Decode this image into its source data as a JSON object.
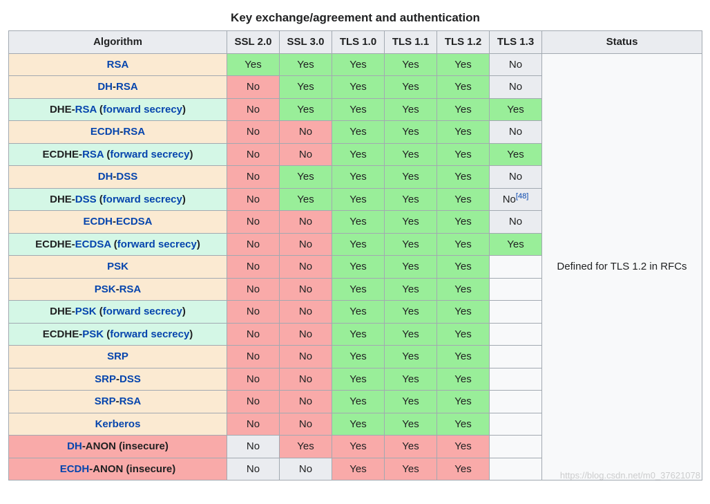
{
  "caption": "Key exchange/agreement and authentication",
  "headers": {
    "algorithm": "Algorithm",
    "protocols": [
      "SSL 2.0",
      "SSL 3.0",
      "TLS 1.0",
      "TLS 1.1",
      "TLS 1.2",
      "TLS 1.3"
    ],
    "status": "Status"
  },
  "status_text": "Defined for TLS 1.2 in RFCs",
  "watermark": "https://blog.csdn.net/m0_37621078",
  "rows": [
    {
      "algBg": "peach",
      "name": [
        {
          "t": "RSA",
          "link": true
        }
      ],
      "cells": [
        {
          "v": "Yes",
          "bg": "green"
        },
        {
          "v": "Yes",
          "bg": "green"
        },
        {
          "v": "Yes",
          "bg": "green"
        },
        {
          "v": "Yes",
          "bg": "green"
        },
        {
          "v": "Yes",
          "bg": "green"
        },
        {
          "v": "No",
          "bg": "grey"
        }
      ]
    },
    {
      "algBg": "peach",
      "name": [
        {
          "t": "DH",
          "link": true
        },
        {
          "t": "-",
          "link": false
        },
        {
          "t": "RSA",
          "link": true
        }
      ],
      "cells": [
        {
          "v": "No",
          "bg": "red"
        },
        {
          "v": "Yes",
          "bg": "green"
        },
        {
          "v": "Yes",
          "bg": "green"
        },
        {
          "v": "Yes",
          "bg": "green"
        },
        {
          "v": "Yes",
          "bg": "green"
        },
        {
          "v": "No",
          "bg": "grey"
        }
      ]
    },
    {
      "algBg": "mint",
      "name": [
        {
          "t": "DHE-",
          "link": false,
          "bold": true
        },
        {
          "t": "RSA",
          "link": true
        },
        {
          "t": " (",
          "link": false,
          "bold": true
        },
        {
          "t": "forward secrecy",
          "link": true
        },
        {
          "t": ")",
          "link": false,
          "bold": true
        }
      ],
      "cells": [
        {
          "v": "No",
          "bg": "red"
        },
        {
          "v": "Yes",
          "bg": "green"
        },
        {
          "v": "Yes",
          "bg": "green"
        },
        {
          "v": "Yes",
          "bg": "green"
        },
        {
          "v": "Yes",
          "bg": "green"
        },
        {
          "v": "Yes",
          "bg": "green"
        }
      ]
    },
    {
      "algBg": "peach",
      "name": [
        {
          "t": "ECDH",
          "link": true
        },
        {
          "t": "-",
          "link": false
        },
        {
          "t": "RSA",
          "link": true
        }
      ],
      "cells": [
        {
          "v": "No",
          "bg": "red"
        },
        {
          "v": "No",
          "bg": "red"
        },
        {
          "v": "Yes",
          "bg": "green"
        },
        {
          "v": "Yes",
          "bg": "green"
        },
        {
          "v": "Yes",
          "bg": "green"
        },
        {
          "v": "No",
          "bg": "grey"
        }
      ]
    },
    {
      "algBg": "mint",
      "name": [
        {
          "t": "ECDHE-",
          "link": false,
          "bold": true
        },
        {
          "t": "RSA",
          "link": true
        },
        {
          "t": " (",
          "link": false,
          "bold": true
        },
        {
          "t": "forward secrecy",
          "link": true
        },
        {
          "t": ")",
          "link": false,
          "bold": true
        }
      ],
      "cells": [
        {
          "v": "No",
          "bg": "red"
        },
        {
          "v": "No",
          "bg": "red"
        },
        {
          "v": "Yes",
          "bg": "green"
        },
        {
          "v": "Yes",
          "bg": "green"
        },
        {
          "v": "Yes",
          "bg": "green"
        },
        {
          "v": "Yes",
          "bg": "green"
        }
      ]
    },
    {
      "algBg": "peach",
      "name": [
        {
          "t": "DH",
          "link": true
        },
        {
          "t": "-",
          "link": false
        },
        {
          "t": "DSS",
          "link": true
        }
      ],
      "cells": [
        {
          "v": "No",
          "bg": "red"
        },
        {
          "v": "Yes",
          "bg": "green"
        },
        {
          "v": "Yes",
          "bg": "green"
        },
        {
          "v": "Yes",
          "bg": "green"
        },
        {
          "v": "Yes",
          "bg": "green"
        },
        {
          "v": "No",
          "bg": "grey"
        }
      ]
    },
    {
      "algBg": "mint",
      "name": [
        {
          "t": "DHE-",
          "link": false,
          "bold": true
        },
        {
          "t": "DSS",
          "link": true
        },
        {
          "t": " (",
          "link": false,
          "bold": true
        },
        {
          "t": "forward secrecy",
          "link": true
        },
        {
          "t": ")",
          "link": false,
          "bold": true
        }
      ],
      "cells": [
        {
          "v": "No",
          "bg": "red"
        },
        {
          "v": "Yes",
          "bg": "green"
        },
        {
          "v": "Yes",
          "bg": "green"
        },
        {
          "v": "Yes",
          "bg": "green"
        },
        {
          "v": "Yes",
          "bg": "green"
        },
        {
          "v": "No",
          "bg": "grey",
          "ref": "[48]"
        }
      ]
    },
    {
      "algBg": "peach",
      "name": [
        {
          "t": "ECDH",
          "link": true
        },
        {
          "t": "-",
          "link": false
        },
        {
          "t": "ECDSA",
          "link": true
        }
      ],
      "cells": [
        {
          "v": "No",
          "bg": "red"
        },
        {
          "v": "No",
          "bg": "red"
        },
        {
          "v": "Yes",
          "bg": "green"
        },
        {
          "v": "Yes",
          "bg": "green"
        },
        {
          "v": "Yes",
          "bg": "green"
        },
        {
          "v": "No",
          "bg": "grey"
        }
      ]
    },
    {
      "algBg": "mint",
      "name": [
        {
          "t": "ECDHE-",
          "link": false,
          "bold": true
        },
        {
          "t": "ECDSA",
          "link": true
        },
        {
          "t": " (",
          "link": false,
          "bold": true
        },
        {
          "t": "forward secrecy",
          "link": true
        },
        {
          "t": ")",
          "link": false,
          "bold": true
        }
      ],
      "cells": [
        {
          "v": "No",
          "bg": "red"
        },
        {
          "v": "No",
          "bg": "red"
        },
        {
          "v": "Yes",
          "bg": "green"
        },
        {
          "v": "Yes",
          "bg": "green"
        },
        {
          "v": "Yes",
          "bg": "green"
        },
        {
          "v": "Yes",
          "bg": "green"
        }
      ]
    },
    {
      "algBg": "peach",
      "name": [
        {
          "t": "PSK",
          "link": true
        }
      ],
      "cells": [
        {
          "v": "No",
          "bg": "red"
        },
        {
          "v": "No",
          "bg": "red"
        },
        {
          "v": "Yes",
          "bg": "green"
        },
        {
          "v": "Yes",
          "bg": "green"
        },
        {
          "v": "Yes",
          "bg": "green"
        },
        {
          "v": "",
          "bg": "blank"
        }
      ]
    },
    {
      "algBg": "peach",
      "name": [
        {
          "t": "PSK",
          "link": true
        },
        {
          "t": "-",
          "link": false
        },
        {
          "t": "RSA",
          "link": true
        }
      ],
      "cells": [
        {
          "v": "No",
          "bg": "red"
        },
        {
          "v": "No",
          "bg": "red"
        },
        {
          "v": "Yes",
          "bg": "green"
        },
        {
          "v": "Yes",
          "bg": "green"
        },
        {
          "v": "Yes",
          "bg": "green"
        },
        {
          "v": "",
          "bg": "blank"
        }
      ]
    },
    {
      "algBg": "mint",
      "name": [
        {
          "t": "DHE-",
          "link": false,
          "bold": true
        },
        {
          "t": "PSK",
          "link": true
        },
        {
          "t": " (",
          "link": false,
          "bold": true
        },
        {
          "t": "forward secrecy",
          "link": true
        },
        {
          "t": ")",
          "link": false,
          "bold": true
        }
      ],
      "cells": [
        {
          "v": "No",
          "bg": "red"
        },
        {
          "v": "No",
          "bg": "red"
        },
        {
          "v": "Yes",
          "bg": "green"
        },
        {
          "v": "Yes",
          "bg": "green"
        },
        {
          "v": "Yes",
          "bg": "green"
        },
        {
          "v": "",
          "bg": "blank"
        }
      ]
    },
    {
      "algBg": "mint",
      "name": [
        {
          "t": "ECDHE-",
          "link": false,
          "bold": true
        },
        {
          "t": "PSK",
          "link": true
        },
        {
          "t": " (",
          "link": false,
          "bold": true
        },
        {
          "t": "forward secrecy",
          "link": true
        },
        {
          "t": ")",
          "link": false,
          "bold": true
        }
      ],
      "cells": [
        {
          "v": "No",
          "bg": "red"
        },
        {
          "v": "No",
          "bg": "red"
        },
        {
          "v": "Yes",
          "bg": "green"
        },
        {
          "v": "Yes",
          "bg": "green"
        },
        {
          "v": "Yes",
          "bg": "green"
        },
        {
          "v": "",
          "bg": "blank"
        }
      ]
    },
    {
      "algBg": "peach",
      "name": [
        {
          "t": "SRP",
          "link": true
        }
      ],
      "cells": [
        {
          "v": "No",
          "bg": "red"
        },
        {
          "v": "No",
          "bg": "red"
        },
        {
          "v": "Yes",
          "bg": "green"
        },
        {
          "v": "Yes",
          "bg": "green"
        },
        {
          "v": "Yes",
          "bg": "green"
        },
        {
          "v": "",
          "bg": "blank"
        }
      ]
    },
    {
      "algBg": "peach",
      "name": [
        {
          "t": "SRP",
          "link": true
        },
        {
          "t": "-",
          "link": false
        },
        {
          "t": "DSS",
          "link": true
        }
      ],
      "cells": [
        {
          "v": "No",
          "bg": "red"
        },
        {
          "v": "No",
          "bg": "red"
        },
        {
          "v": "Yes",
          "bg": "green"
        },
        {
          "v": "Yes",
          "bg": "green"
        },
        {
          "v": "Yes",
          "bg": "green"
        },
        {
          "v": "",
          "bg": "blank"
        }
      ]
    },
    {
      "algBg": "peach",
      "name": [
        {
          "t": "SRP",
          "link": true
        },
        {
          "t": "-",
          "link": false
        },
        {
          "t": "RSA",
          "link": true
        }
      ],
      "cells": [
        {
          "v": "No",
          "bg": "red"
        },
        {
          "v": "No",
          "bg": "red"
        },
        {
          "v": "Yes",
          "bg": "green"
        },
        {
          "v": "Yes",
          "bg": "green"
        },
        {
          "v": "Yes",
          "bg": "green"
        },
        {
          "v": "",
          "bg": "blank"
        }
      ]
    },
    {
      "algBg": "peach",
      "name": [
        {
          "t": "Kerberos",
          "link": true
        }
      ],
      "cells": [
        {
          "v": "No",
          "bg": "red"
        },
        {
          "v": "No",
          "bg": "red"
        },
        {
          "v": "Yes",
          "bg": "green"
        },
        {
          "v": "Yes",
          "bg": "green"
        },
        {
          "v": "Yes",
          "bg": "green"
        },
        {
          "v": "",
          "bg": "blank"
        }
      ]
    },
    {
      "algBg": "red",
      "name": [
        {
          "t": "DH",
          "link": true
        },
        {
          "t": "-ANON (insecure)",
          "link": false,
          "bold": true
        }
      ],
      "cells": [
        {
          "v": "No",
          "bg": "grey"
        },
        {
          "v": "Yes",
          "bg": "red"
        },
        {
          "v": "Yes",
          "bg": "red"
        },
        {
          "v": "Yes",
          "bg": "red"
        },
        {
          "v": "Yes",
          "bg": "red"
        },
        {
          "v": "",
          "bg": "blank"
        }
      ]
    },
    {
      "algBg": "red",
      "name": [
        {
          "t": "ECDH",
          "link": true
        },
        {
          "t": "-ANON (insecure)",
          "link": false,
          "bold": true
        }
      ],
      "cells": [
        {
          "v": "No",
          "bg": "grey"
        },
        {
          "v": "No",
          "bg": "grey"
        },
        {
          "v": "Yes",
          "bg": "red"
        },
        {
          "v": "Yes",
          "bg": "red"
        },
        {
          "v": "Yes",
          "bg": "red"
        },
        {
          "v": "",
          "bg": "blank"
        }
      ]
    }
  ]
}
